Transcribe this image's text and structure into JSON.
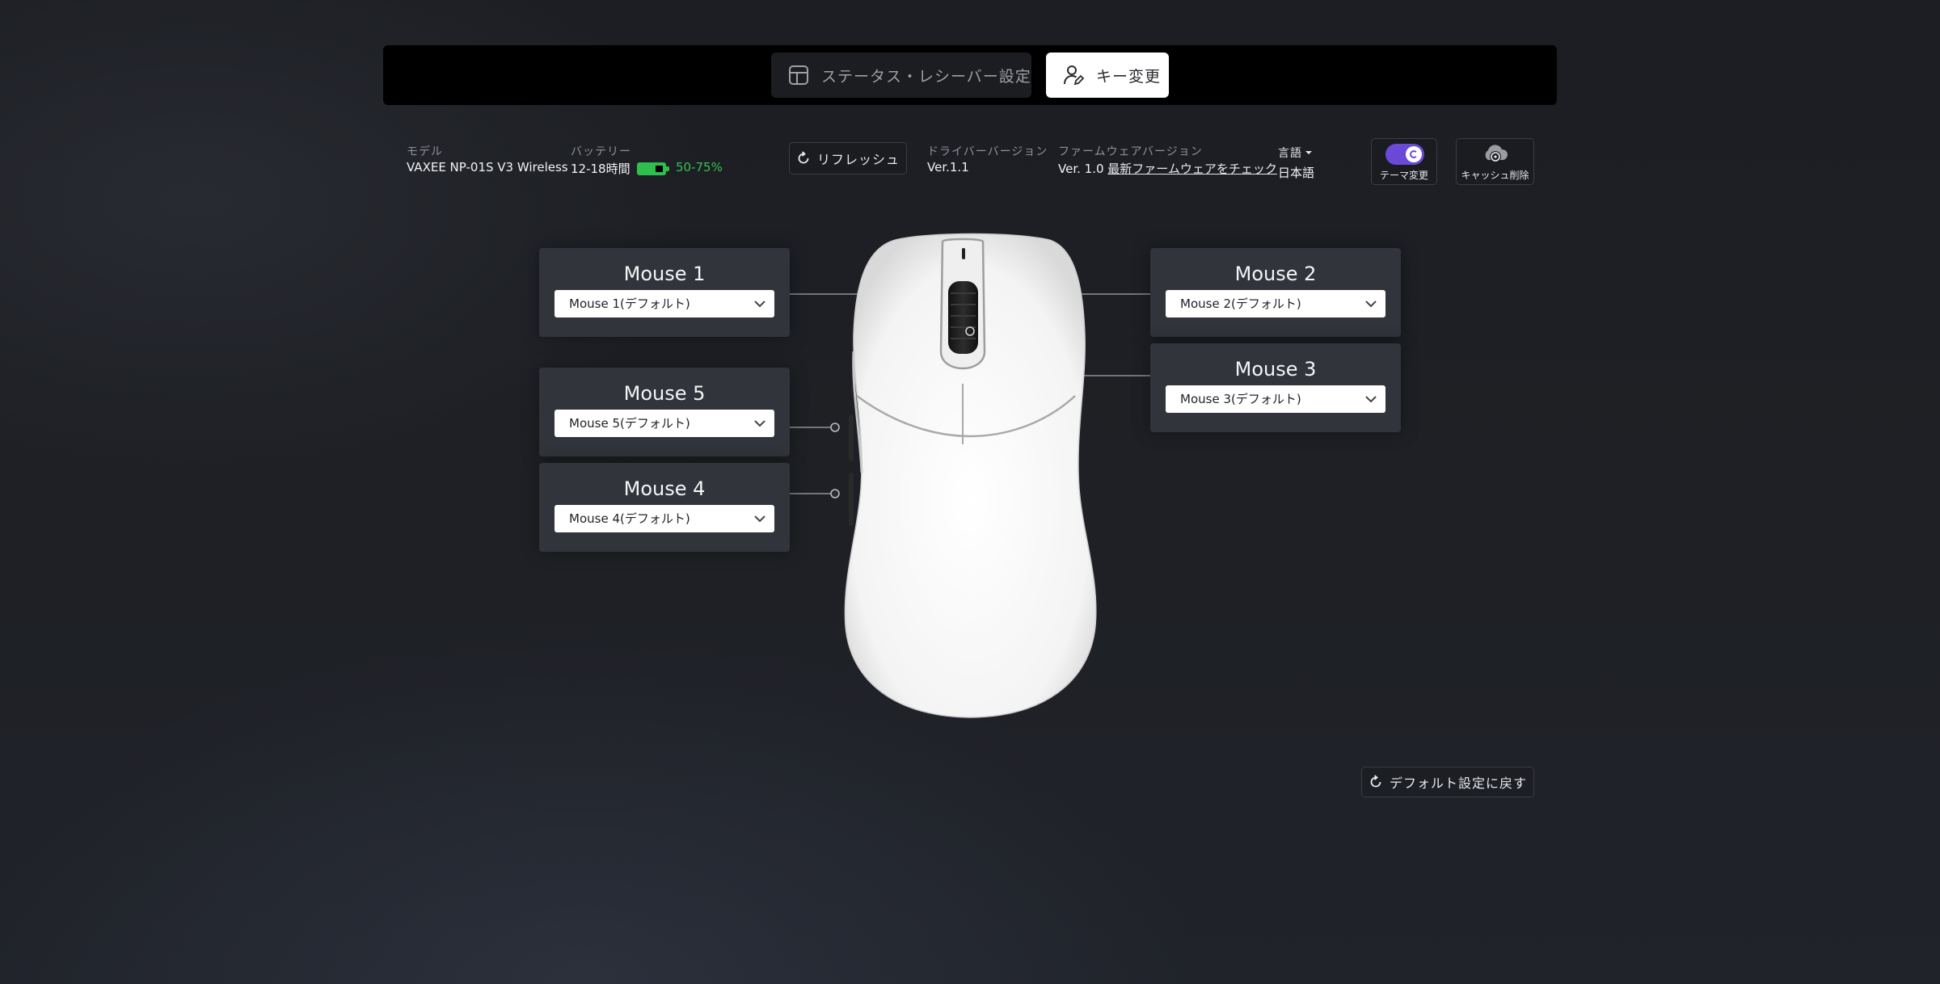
{
  "tabs": {
    "status": {
      "label": "ステータス・レシーバー設定",
      "icon": "layout-icon"
    },
    "keys": {
      "label": "キー変更",
      "icon": "user-edit-icon"
    }
  },
  "info": {
    "model": {
      "label": "モデル",
      "value": "VAXEE NP-01S V3 Wireless"
    },
    "battery": {
      "label": "バッテリー",
      "value": "12-18時間",
      "percent": "50-75%",
      "color": "#2fbf4c"
    },
    "refresh_label": "リフレッシュ",
    "driver": {
      "label": "ドライバーバージョン",
      "value": "Ver.1.1"
    },
    "firmware": {
      "label": "ファームウェアバージョン",
      "value": "Ver. 1.0",
      "link": "最新ファームウェアをチェック"
    },
    "language": {
      "label": "言語",
      "value": "日本語"
    },
    "theme": {
      "label": "テーマ変更",
      "on": true,
      "accent": "#6b49d6"
    },
    "cache": {
      "label": "キャッシュ削除"
    }
  },
  "buttons": {
    "mouse1": {
      "title": "Mouse 1",
      "value": "Mouse 1(デフォルト)"
    },
    "mouse2": {
      "title": "Mouse 2",
      "value": "Mouse 2(デフォルト)"
    },
    "mouse3": {
      "title": "Mouse 3",
      "value": "Mouse 3(デフォルト)"
    },
    "mouse4": {
      "title": "Mouse 4",
      "value": "Mouse 4(デフォルト)"
    },
    "mouse5": {
      "title": "Mouse 5",
      "value": "Mouse 5(デフォルト)"
    }
  },
  "reset_label": "デフォルト設定に戻す"
}
